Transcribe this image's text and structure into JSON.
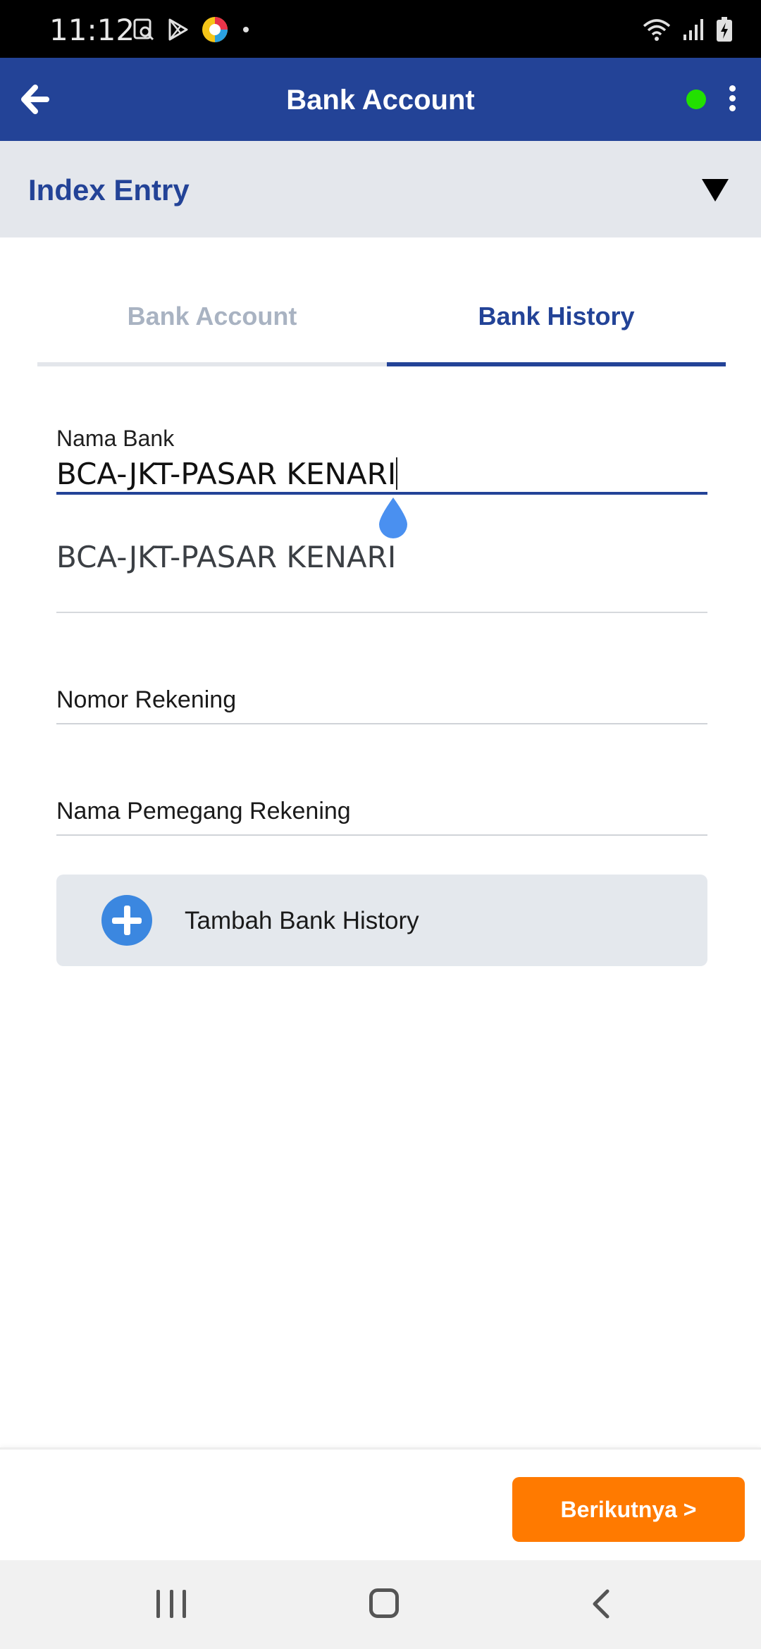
{
  "status_bar": {
    "time": "11:12",
    "left_icons": [
      "screenshot-icon",
      "play-store-icon",
      "app-badge-icon",
      "dot-icon"
    ],
    "right_icons": [
      "wifi-icon",
      "signal-icon",
      "battery-charging-icon"
    ]
  },
  "app_bar": {
    "title": "Bank Account",
    "status_color": "#22e000"
  },
  "index_entry": {
    "title": "Index Entry"
  },
  "tabs": [
    {
      "label": "Bank Account",
      "active": false
    },
    {
      "label": "Bank History",
      "active": true
    }
  ],
  "form": {
    "nama_bank": {
      "label": "Nama Bank",
      "value": "BCA-JKT-PASAR KENARI"
    },
    "suggestion": "BCA-JKT-PASAR KENARI",
    "nomor_rekening": {
      "placeholder": "Nomor Rekening"
    },
    "nama_pemegang": {
      "placeholder": "Nama Pemegang Rekening"
    },
    "add_button": "Tambah Bank History"
  },
  "footer": {
    "next_label": "Berikutnya >"
  },
  "colors": {
    "primary": "#234397",
    "accent": "#ff7a00",
    "tab_inactive": "#a9b3c2",
    "add_icon": "#3b87e0"
  }
}
